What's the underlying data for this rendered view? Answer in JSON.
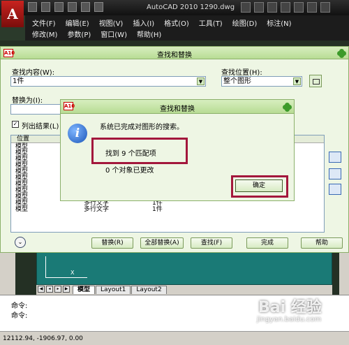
{
  "app": {
    "title": "AutoCAD 2010    1290.dwg",
    "logo": "A"
  },
  "menu": {
    "row1": [
      "文件(F)",
      "编辑(E)",
      "视图(V)",
      "插入(I)",
      "格式(O)",
      "工具(T)",
      "绘图(D)",
      "标注(N)"
    ],
    "row2": [
      "修改(M)",
      "参数(P)",
      "窗口(W)",
      "帮助(H)"
    ]
  },
  "find_dialog": {
    "title": "查找和替换",
    "find_label": "查找内容(W):",
    "find_value": "1件",
    "location_label": "查找位置(H):",
    "location_value": "整个图形",
    "replace_label": "替换为(I):",
    "replace_value": "",
    "list_results_label": "列出结果(L)",
    "list_results_checked": "✓",
    "column_location": "位置",
    "rows": [
      {
        "loc": "模型",
        "type": "",
        "content": ""
      },
      {
        "loc": "模型",
        "type": "",
        "content": ""
      },
      {
        "loc": "模型",
        "type": "",
        "content": ""
      },
      {
        "loc": "模型",
        "type": "",
        "content": ""
      },
      {
        "loc": "模型",
        "type": "",
        "content": ""
      },
      {
        "loc": "模型",
        "type": "",
        "content": ""
      },
      {
        "loc": "模型",
        "type": "",
        "content": ""
      },
      {
        "loc": "模型",
        "type": "",
        "content": ""
      },
      {
        "loc": "模型",
        "type": "",
        "content": ""
      },
      {
        "loc": "模型",
        "type": "多行文字",
        "content": "1件"
      },
      {
        "loc": "模型",
        "type": "多行文字",
        "content": "1件"
      }
    ],
    "buttons": {
      "replace": "替换(R)",
      "replace_all": "全部替换(A)",
      "find": "查找(F)",
      "done": "完成",
      "help": "帮助"
    },
    "expand": "⌄"
  },
  "message_box": {
    "title": "查找和替换",
    "line1": "系统已完成对图形的搜索。",
    "line2": "找到 9 个匹配项",
    "line3": "0 个对象已更改",
    "ok": "确定",
    "info": "i"
  },
  "layout": {
    "tabs": [
      "模型",
      "Layout1",
      "Layout2"
    ],
    "xaxis": "X"
  },
  "command": {
    "line1": "命令:",
    "line2": "命令:"
  },
  "status": {
    "coords": "12112.94, -1906.97, 0.00"
  },
  "watermark": {
    "main": "Bai 经验",
    "sub": "jingyan.baidu.com"
  },
  "colors": {
    "dialog_bg": "#eef6e4",
    "highlight_box": "#a3173c",
    "model_bg": "#1a7a76"
  }
}
